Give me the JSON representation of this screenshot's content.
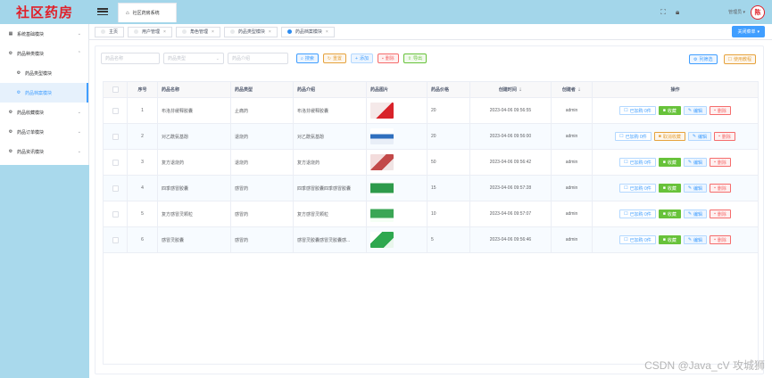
{
  "app": {
    "logo": "社区药房",
    "system_tab": "社区药房系统",
    "user_name": "管理员",
    "avatar_text": "陈"
  },
  "sidebar": {
    "items": [
      {
        "label": "系统基础模块",
        "level": 0
      },
      {
        "label": "药品种类模块",
        "level": 0
      },
      {
        "label": "药品类型模块",
        "level": 1
      },
      {
        "label": "药品档案模块",
        "level": 1,
        "active": true
      },
      {
        "label": "药品收藏模块",
        "level": 0
      },
      {
        "label": "药品订单模块",
        "level": 0
      },
      {
        "label": "药品资讯模块",
        "level": 0
      }
    ]
  },
  "tabs": [
    {
      "label": "主页"
    },
    {
      "label": "用户管理"
    },
    {
      "label": "角色管理"
    },
    {
      "label": "药品类型模块"
    },
    {
      "label": "药品档案模块",
      "active": true
    }
  ],
  "close_menu_label": "关闭菜单",
  "filters": {
    "name_placeholder": "药品名称",
    "type_placeholder": "药品类型",
    "intro_placeholder": "药品介绍"
  },
  "buttons": {
    "search": "搜索",
    "reset": "重置",
    "add": "添加",
    "delete": "删除",
    "export": "导出",
    "column_filter": "列筛选",
    "tutorial": "使用教程"
  },
  "table": {
    "headers": [
      "序号",
      "药品名称",
      "药品类型",
      "药品介绍",
      "药品图片",
      "药品价格",
      "创建时间",
      "创建者",
      "操作"
    ],
    "rows": [
      {
        "idx": "1",
        "name": "布洛芬缓释胶囊",
        "type": "止痛药",
        "intro": "布洛芬缓释胶囊",
        "price": "20",
        "time": "2023-04-06 09:56:55",
        "creator": "admin",
        "fav": "收藏",
        "favored": false
      },
      {
        "idx": "2",
        "name": "对乙酰氨基酚",
        "type": "退烧药",
        "intro": "对乙酰氨基酚",
        "price": "20",
        "time": "2023-04-06 09:56:00",
        "creator": "admin",
        "fav": "取消收藏",
        "favored": true
      },
      {
        "idx": "3",
        "name": "复方退烧药",
        "type": "退烧药",
        "intro": "复方退烧药",
        "price": "50",
        "time": "2023-04-06 09:56:42",
        "creator": "admin",
        "fav": "收藏",
        "favored": false
      },
      {
        "idx": "4",
        "name": "四季感冒胶囊",
        "type": "感冒药",
        "intro": "四季感冒胶囊四季感冒胶囊",
        "price": "15",
        "time": "2023-04-06 09:57:28",
        "creator": "admin",
        "fav": "收藏",
        "favored": false
      },
      {
        "idx": "5",
        "name": "复方感冒灵颗粒",
        "type": "感冒药",
        "intro": "复方感冒灵颗粒",
        "price": "10",
        "time": "2023-04-06 09:57:07",
        "creator": "admin",
        "fav": "收藏",
        "favored": false
      },
      {
        "idx": "6",
        "name": "感冒灵胶囊",
        "type": "感冒药",
        "intro": "感冒灵胶囊感冒灵胶囊感...",
        "price": "5",
        "time": "2023-04-06 09:56:46",
        "creator": "admin",
        "fav": "收藏",
        "favored": false
      }
    ],
    "op_cart": "已加购 0件",
    "op_edit": "编辑",
    "op_delete": "删除"
  },
  "watermark": "CSDN @Java_cV 攻城狮",
  "colors": {
    "brand": "#e0202a",
    "primary": "#409eff",
    "success": "#67c23a",
    "warning": "#e6a23c",
    "danger": "#f56c6c"
  }
}
